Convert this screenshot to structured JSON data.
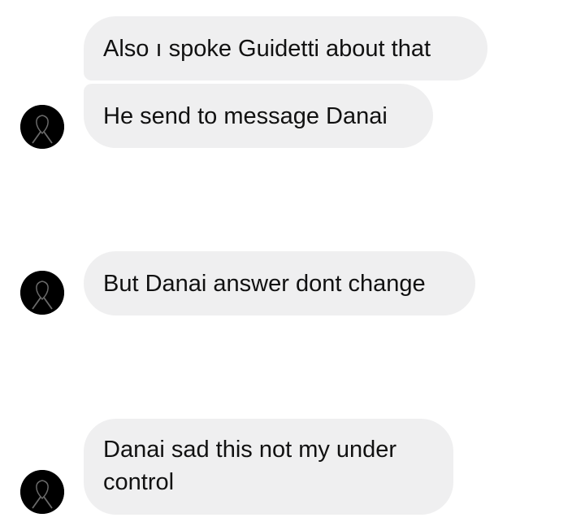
{
  "conversation": {
    "messages": [
      {
        "text": "Also ı spoke Guidetti about that"
      },
      {
        "text": "He send to message Danai"
      },
      {
        "text": "But Danai answer dont change"
      },
      {
        "text": "Danai sad this not my under control"
      }
    ]
  },
  "avatar_icon": "black-ribbon-icon",
  "colors": {
    "bubble_background": "#efeff0",
    "text": "#111111",
    "avatar": "#000000"
  }
}
